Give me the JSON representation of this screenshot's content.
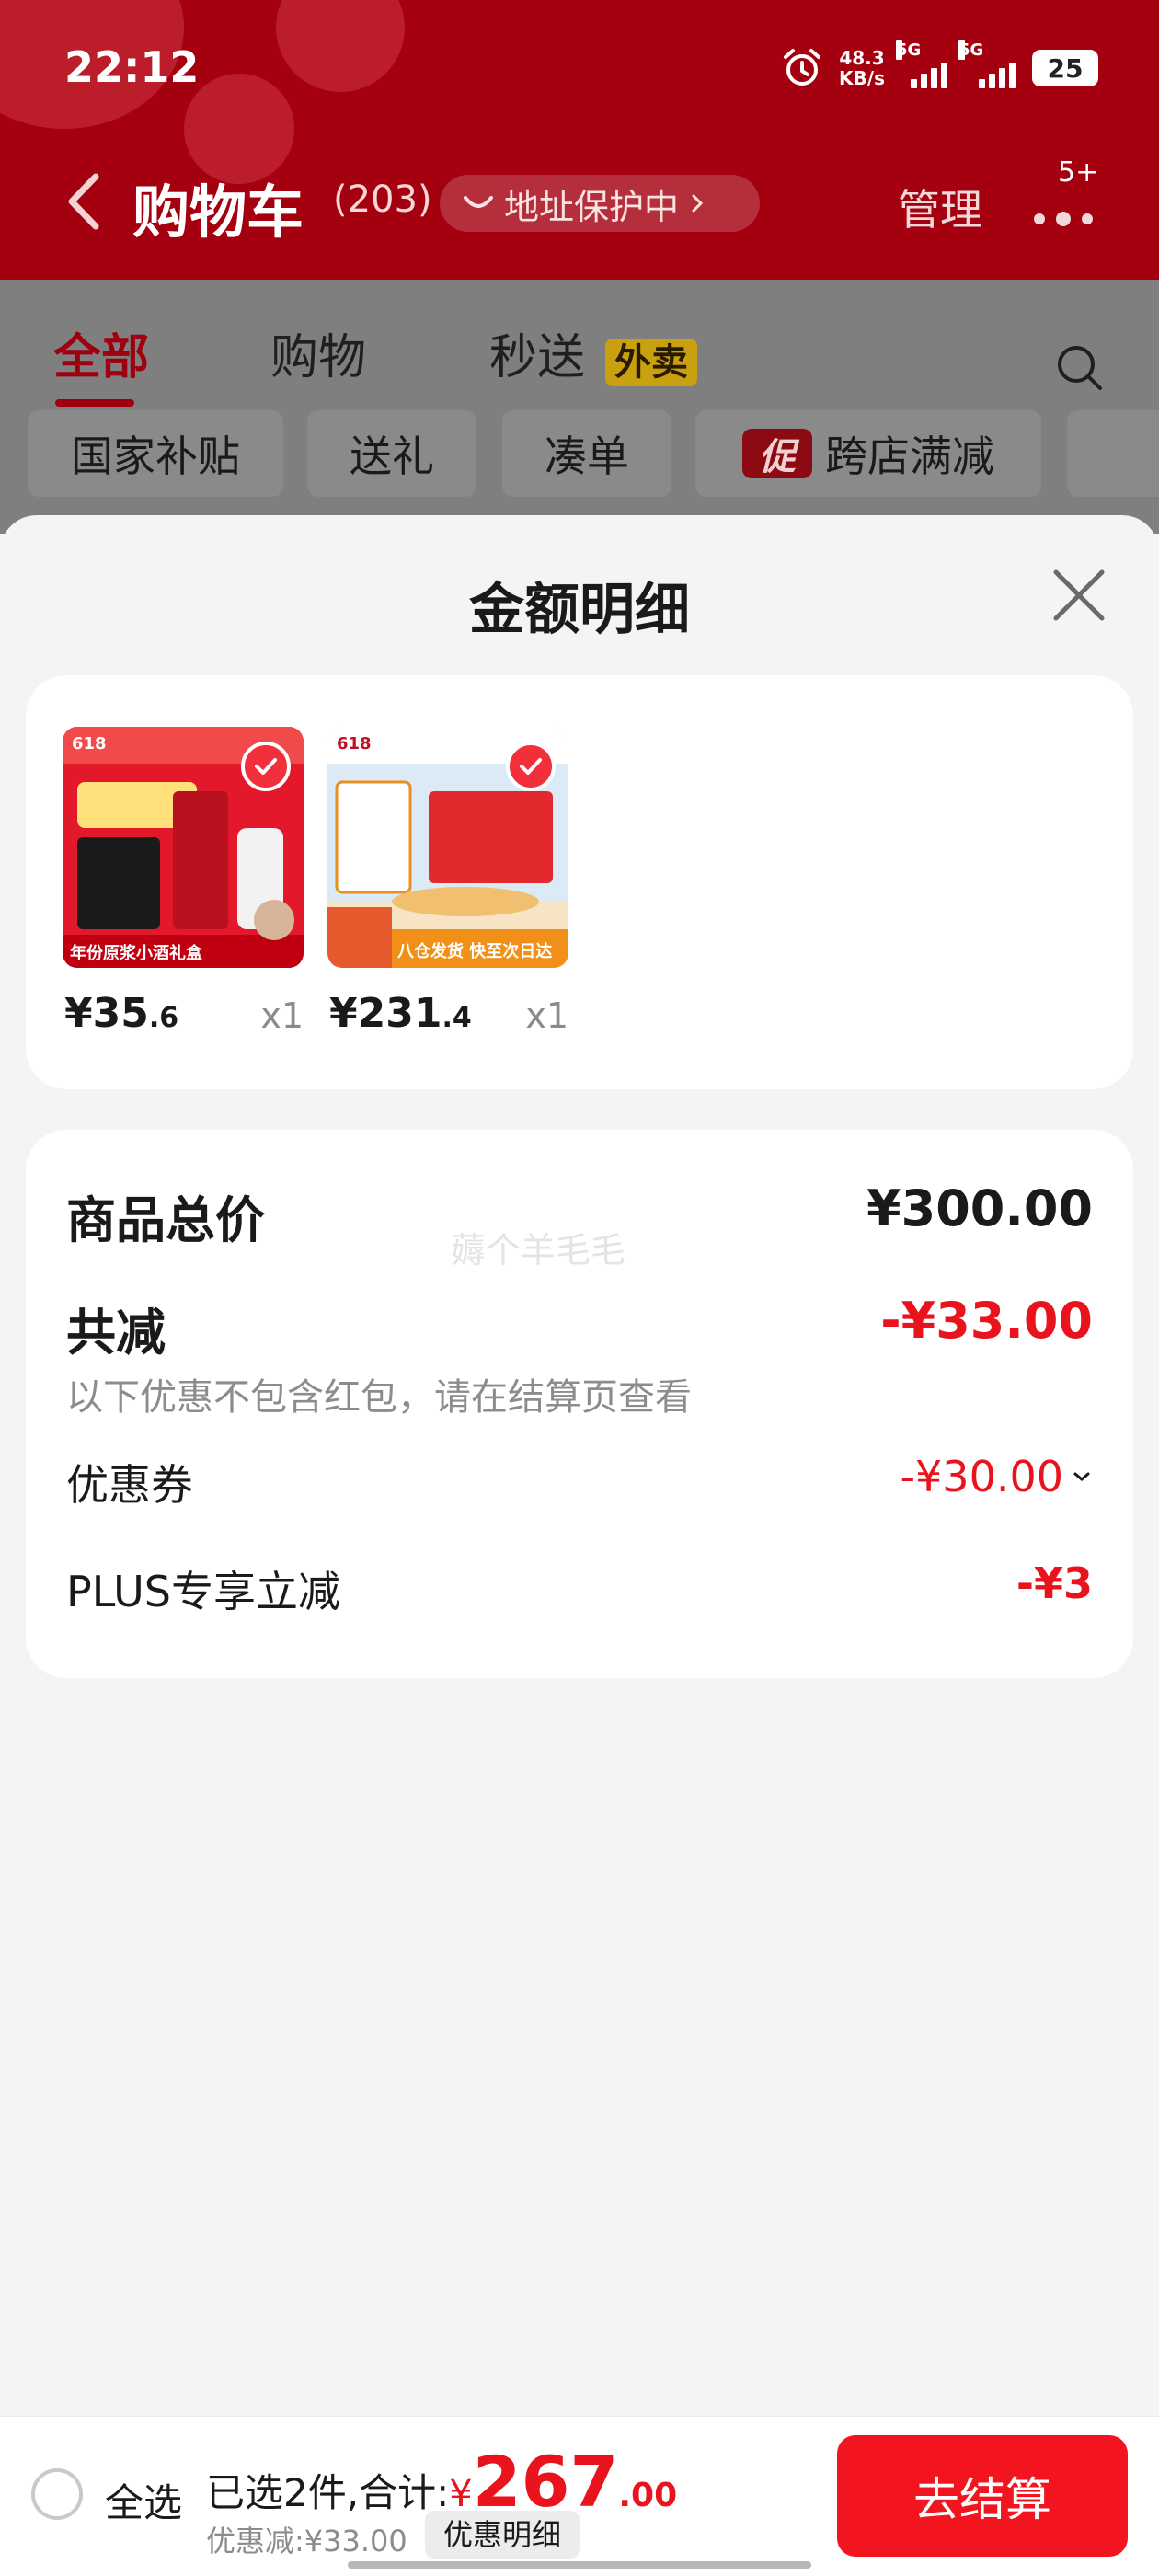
{
  "status_bar": {
    "time": "22:12",
    "speed_value": "48.3",
    "speed_unit": "KB/s",
    "sim1": "5G",
    "sim2": "5G",
    "battery": "25"
  },
  "nav": {
    "title": "购物车",
    "count": "(203)",
    "address_protection": "地址保护中",
    "manage": "管理",
    "more_badge": "5+"
  },
  "tabs": [
    {
      "label": "全部",
      "active": true
    },
    {
      "label": "购物",
      "active": false
    },
    {
      "label": "秒送",
      "active": false
    }
  ],
  "takeout_badge": "外卖",
  "chips": [
    "国家补贴",
    "送礼",
    "凑单",
    "跨店满减"
  ],
  "promo_badge": "促",
  "sheet": {
    "title": "金额明细"
  },
  "items": [
    {
      "price_int": "¥35",
      "price_dec": ".6",
      "qty": "x1",
      "thumb_text_top": "618",
      "thumb_text_bottom": "年份原浆小酒礼盒"
    },
    {
      "price_int": "¥231",
      "price_dec": ".4",
      "qty": "x1",
      "thumb_text_top": "618",
      "thumb_text_bottom": "八仓发货 快至次日达"
    }
  ],
  "summary": {
    "total_label": "商品总价",
    "total_value": "¥300.00",
    "watermark": "薅个羊毛毛",
    "discount_label": "共减",
    "discount_value": "-¥33.00",
    "discount_note": "以下优惠不包含红包，请在结算页查看",
    "coupon_label": "优惠券",
    "coupon_value": "-¥30.00",
    "plus_label": "PLUS专享立减",
    "plus_value": "-¥3"
  },
  "bottom": {
    "select_all": "全选",
    "selected_prefix": "已选2件,合计:",
    "currency": "¥",
    "total_int": "267",
    "total_dec": ".00",
    "saved": "优惠减:¥33.00",
    "detail_button": "优惠明细",
    "checkout": "去结算"
  },
  "colors": {
    "header_red": "#a40010",
    "accent_red": "#e8131c",
    "checkout_red": "#f2141f"
  }
}
